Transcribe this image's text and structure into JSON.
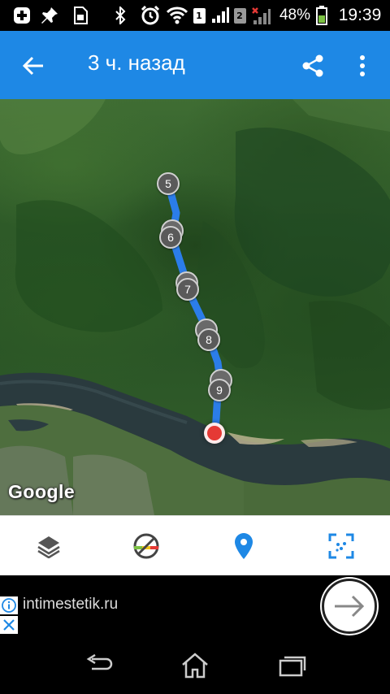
{
  "status_bar": {
    "sim1": "1",
    "sim2": "2",
    "battery": "48%",
    "time": "19:39"
  },
  "toolbar": {
    "title": "3 ч. назад"
  },
  "map": {
    "google_logo": "Google",
    "markers": [
      {
        "label": "5"
      },
      {
        "label": "6"
      },
      {
        "label": "7"
      },
      {
        "label": "8"
      },
      {
        "label": "9"
      }
    ],
    "route_color": "#2b7de9",
    "current_color": "#e53935"
  },
  "action_bar": {
    "items": [
      "layers-icon",
      "speed-limit-icon",
      "location-pin-icon",
      "fit-bounds-icon"
    ],
    "accent": "#1e88e5"
  },
  "ad": {
    "text": "intimestetik.ru"
  },
  "nav": {
    "items": [
      "back-icon",
      "home-icon",
      "recent-apps-icon"
    ]
  }
}
